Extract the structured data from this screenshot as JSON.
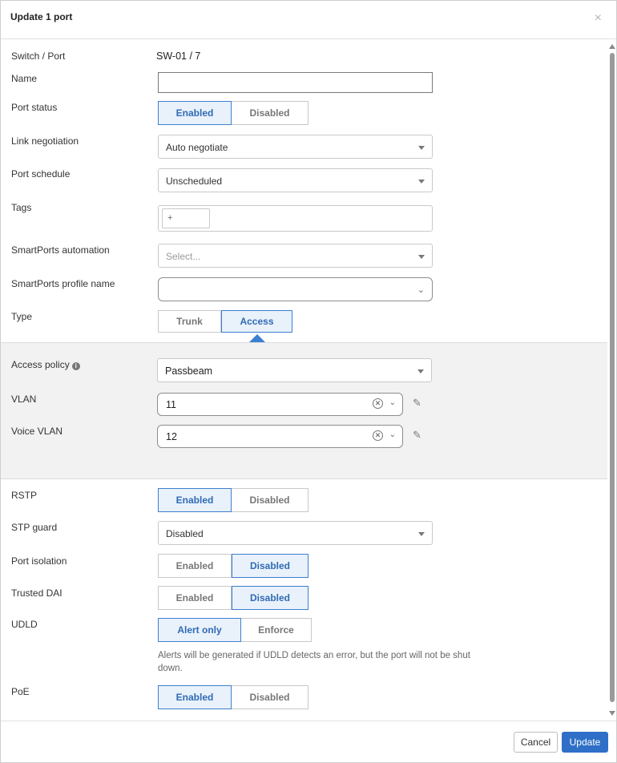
{
  "dialog": {
    "title": "Update 1 port",
    "close_glyph": "×"
  },
  "fields": {
    "switch_port": {
      "label": "Switch / Port",
      "value": "SW-01 / 7"
    },
    "name": {
      "label": "Name",
      "value": ""
    },
    "port_status": {
      "label": "Port status",
      "options": [
        "Enabled",
        "Disabled"
      ],
      "selected": "Enabled"
    },
    "link_negotiation": {
      "label": "Link negotiation",
      "value": "Auto negotiate"
    },
    "port_schedule": {
      "label": "Port schedule",
      "value": "Unscheduled"
    },
    "tags": {
      "label": "Tags",
      "add_label": "+"
    },
    "smartports_automation": {
      "label": "SmartPorts automation",
      "placeholder": "Select..."
    },
    "smartports_profile": {
      "label": "SmartPorts profile name",
      "value": ""
    },
    "type": {
      "label": "Type",
      "options": [
        "Trunk",
        "Access"
      ],
      "selected": "Access"
    },
    "access_policy": {
      "label": "Access policy",
      "value": "Passbeam"
    },
    "vlan": {
      "label": "VLAN",
      "value": "11"
    },
    "voice_vlan": {
      "label": "Voice VLAN",
      "value": "12"
    },
    "rstp": {
      "label": "RSTP",
      "options": [
        "Enabled",
        "Disabled"
      ],
      "selected": "Enabled"
    },
    "stp_guard": {
      "label": "STP guard",
      "value": "Disabled"
    },
    "port_isolation": {
      "label": "Port isolation",
      "options": [
        "Enabled",
        "Disabled"
      ],
      "selected": "Disabled"
    },
    "trusted_dai": {
      "label": "Trusted DAI",
      "options": [
        "Enabled",
        "Disabled"
      ],
      "selected": "Disabled"
    },
    "udld": {
      "label": "UDLD",
      "options": [
        "Alert only",
        "Enforce"
      ],
      "selected": "Alert only",
      "note": "Alerts will be generated if UDLD detects an error, but the port will not be shut down."
    },
    "poe": {
      "label": "PoE",
      "options": [
        "Enabled",
        "Disabled"
      ],
      "selected": "Enabled"
    }
  },
  "footer": {
    "cancel_label": "Cancel",
    "update_label": "Update"
  },
  "colors": {
    "accent": "#2f6fc7",
    "selected_bg": "#e9f1fb",
    "section_bg": "#f2f2f2"
  }
}
